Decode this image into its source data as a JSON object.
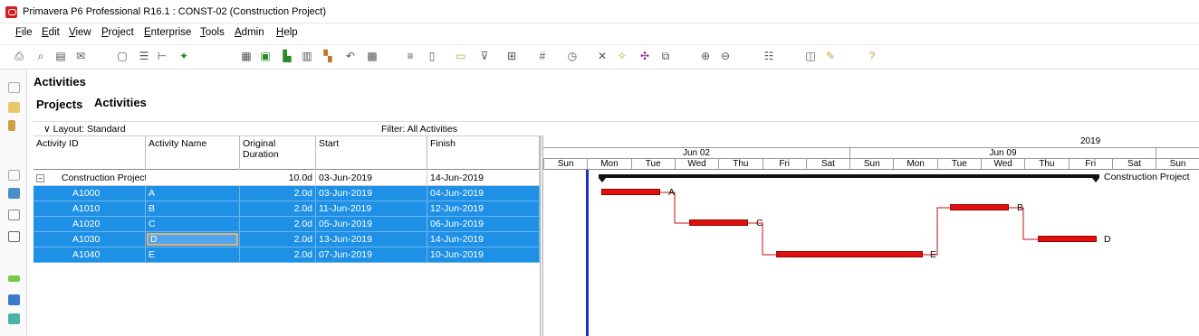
{
  "window": {
    "title": "Primavera P6 Professional R16.1 : CONST-02 (Construction Project)"
  },
  "menu": [
    "File",
    "Edit",
    "View",
    "Project",
    "Enterprise",
    "Tools",
    "Admin",
    "Help"
  ],
  "page": {
    "title": "Activities",
    "tabs": [
      "Projects",
      "Activities"
    ]
  },
  "layout_bar": {
    "layout": "Layout: Standard",
    "filter": "Filter: All Activities"
  },
  "columns": [
    "Activity ID",
    "Activity Name",
    "Original Duration",
    "Start",
    "Finish"
  ],
  "wbs_row": {
    "name": "Construction Project",
    "duration": "10.0d",
    "start": "03-Jun-2019",
    "finish": "14-Jun-2019"
  },
  "activities": [
    {
      "id": "A1000",
      "name": "A",
      "duration": "2.0d",
      "start": "03-Jun-2019",
      "finish": "04-Jun-2019"
    },
    {
      "id": "A1010",
      "name": "B",
      "duration": "2.0d",
      "start": "11-Jun-2019",
      "finish": "12-Jun-2019"
    },
    {
      "id": "A1020",
      "name": "C",
      "duration": "2.0d",
      "start": "05-Jun-2019",
      "finish": "06-Jun-2019"
    },
    {
      "id": "A1030",
      "name": "D",
      "duration": "2.0d",
      "start": "13-Jun-2019",
      "finish": "14-Jun-2019"
    },
    {
      "id": "A1040",
      "name": "E",
      "duration": "2.0d",
      "start": "07-Jun-2019",
      "finish": "10-Jun-2019"
    }
  ],
  "gantt": {
    "year": "2019",
    "weeks": [
      "Jun 02",
      "Jun 09"
    ],
    "days": [
      "Sun",
      "Mon",
      "Tue",
      "Wed",
      "Thu",
      "Fri",
      "Sat",
      "Sun",
      "Mon",
      "Tue",
      "Wed",
      "Thu",
      "Fri",
      "Sat",
      "Sun"
    ],
    "summary_label": "Construction Project",
    "bar_labels": [
      "A",
      "C",
      "E",
      "B",
      "D"
    ]
  },
  "colors": {
    "selection": "#1e90e6",
    "bar": "#e01010",
    "data_date": "#1e2ec8"
  }
}
